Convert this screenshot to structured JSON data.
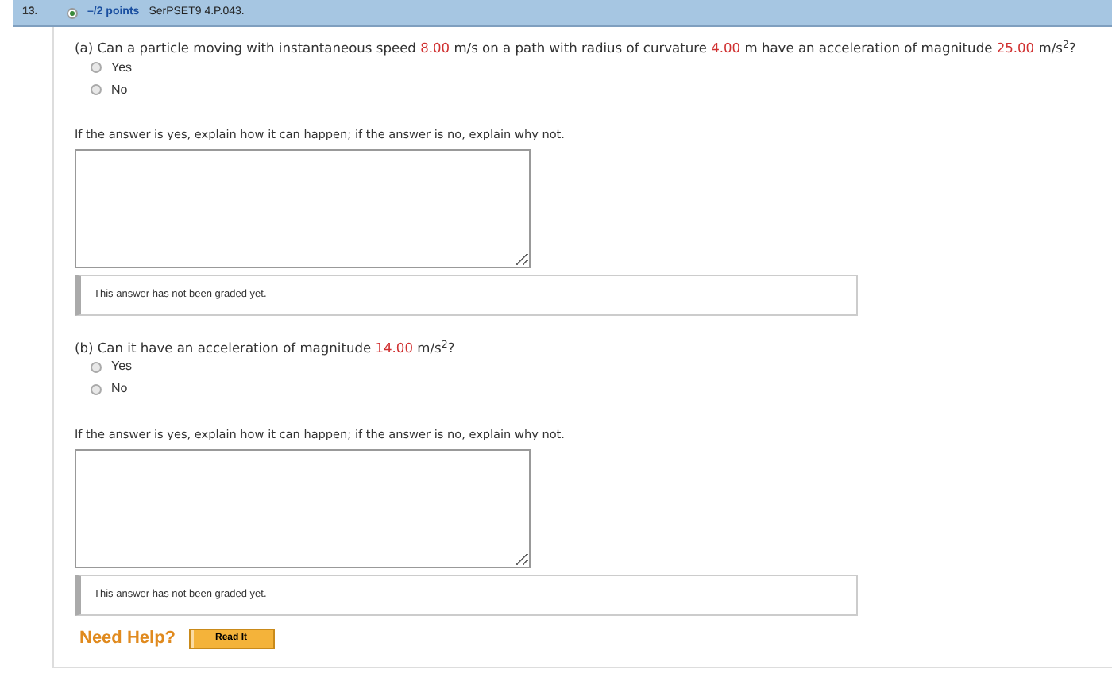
{
  "header": {
    "number": "13.",
    "points": "–/2 points",
    "code": "SerPSET9 4.P.043."
  },
  "parts": [
    {
      "question": [
        {
          "kind": "plain",
          "text": "(a) Can a particle moving with instantaneous speed "
        },
        {
          "kind": "value",
          "text": "8.00"
        },
        {
          "kind": "plain",
          "text": " m/s on a path with radius of curvature "
        },
        {
          "kind": "value",
          "text": "4.00"
        },
        {
          "kind": "plain",
          "text": " m have an acceleration of magnitude "
        },
        {
          "kind": "value",
          "text": "25.00"
        },
        {
          "kind": "plain",
          "text": " m/s$^{2}$?"
        }
      ],
      "options": [
        {
          "label": "Yes",
          "selected": false
        },
        {
          "label": "No",
          "selected": false
        }
      ],
      "prompt": "If the answer is yes, explain how it can happen; if the answer is no, explain why not.",
      "status": "This answer has not been graded yet."
    },
    {
      "question": [
        {
          "kind": "plain",
          "text": "(b) Can it have an acceleration of magnitude "
        },
        {
          "kind": "value",
          "text": "14.00"
        },
        {
          "kind": "plain",
          "text": " m/s$^{2}$?"
        }
      ],
      "options": [
        {
          "label": "Yes",
          "selected": false
        },
        {
          "label": "No",
          "selected": false
        }
      ],
      "prompt": "If the answer is yes, explain how it can happen; if the answer is no, explain why not.",
      "status": "This answer has not been graded yet."
    }
  ],
  "help": {
    "label": "Need Help?",
    "button": "Read It"
  }
}
